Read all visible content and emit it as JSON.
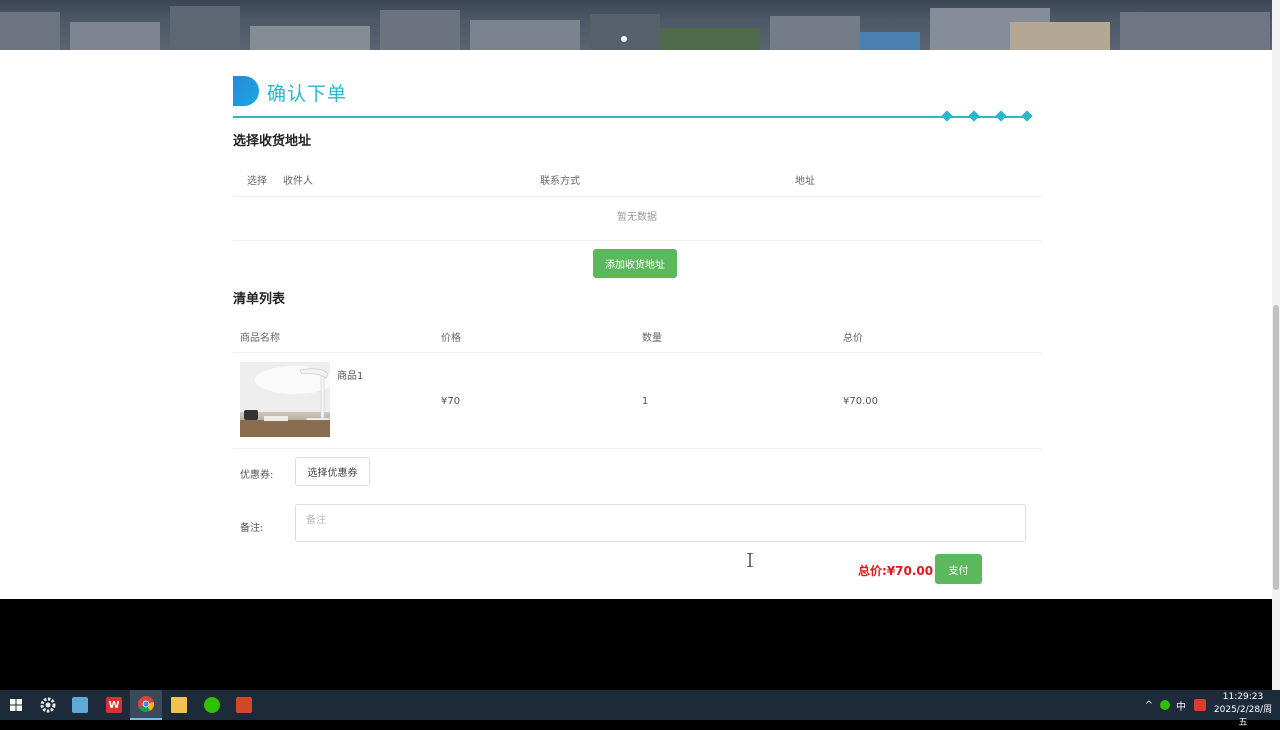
{
  "section": {
    "title": "确认下单"
  },
  "address": {
    "title": "选择收货地址",
    "columns": [
      "选择",
      "收件人",
      "联系方式",
      "地址"
    ],
    "empty_text": "暂无数据",
    "add_button": "添加收货地址"
  },
  "order_list": {
    "title": "清单列表",
    "columns": [
      "商品名称",
      "价格",
      "数量",
      "总价"
    ],
    "rows": [
      {
        "name": "商品1",
        "price": "¥70",
        "quantity": "1",
        "total": "¥70.00"
      }
    ]
  },
  "coupon": {
    "label": "优惠券:",
    "button": "选择优惠券"
  },
  "remark": {
    "label": "备注:",
    "placeholder": "备注",
    "value": ""
  },
  "summary": {
    "total_label": "总价:",
    "total_value": "¥70.00",
    "pay_button": "支付"
  },
  "taskbar": {
    "apps": [
      "start-icon",
      "settings-app-icon",
      "notepad-app-icon",
      "wps-app-icon",
      "chrome-app-icon",
      "file-explorer-icon",
      "wechat-app-icon",
      "presentation-app-icon"
    ],
    "ime": "中",
    "time": "11:29:23",
    "date": "2025/2/28/周五"
  },
  "colors": {
    "accent": "#2bb6c9",
    "button_green": "#5cb85c",
    "price_red": "#e4161c"
  }
}
